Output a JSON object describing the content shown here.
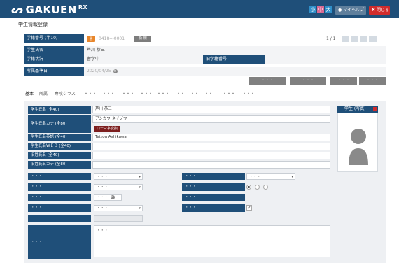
{
  "app": {
    "logo": "GAKUEN",
    "logo_suffix": "RX",
    "font_sizes": [
      "小",
      "中",
      "大"
    ],
    "help_label": "マイヘルプ",
    "close_label": "閉じる"
  },
  "page": {
    "title": "学生情報登録"
  },
  "header_fields": {
    "student_no_label": "学籍番号 (半10)",
    "student_no_value": "0418---0001",
    "new_label": "新 規",
    "name_label": "学生氏名",
    "name_value": "芦川 恭三",
    "status_label": "学籍状況",
    "status_value": "留学中",
    "old_no_label": "旧学籍番号",
    "old_no_value": "",
    "base_date_label": "所属基準日",
    "base_date_value": "2020/04/25",
    "page_count": "1 / 1",
    "action_buttons": [
      "・・・",
      "・・・",
      "・・・",
      "・・・"
    ]
  },
  "tabs": [
    "基本",
    "所属",
    "専攻クラス",
    "・・・",
    "・・・",
    "・・・",
    "・・・",
    "・・・",
    "・・",
    "・・",
    "・・",
    "・・・",
    "・・・"
  ],
  "form": {
    "name_label": "学生氏名 (全40)",
    "name_value": "芦川 恭三",
    "kana_label": "学生氏名カナ (全80)",
    "kana_value": "アシカワ タイゾウ",
    "romaji_button": "ローマ字変換",
    "english_label": "学生氏名英語 (全40)",
    "english_value": "Taizou Ashikawa",
    "web_label": "学生氏名ＷＥＢ (全40)",
    "old_name_label": "旧姓氏名 (全40)",
    "old_kana_label": "旧姓氏名カナ (全80)",
    "dots": "・・・",
    "photo_label": "学生 (写真)"
  }
}
